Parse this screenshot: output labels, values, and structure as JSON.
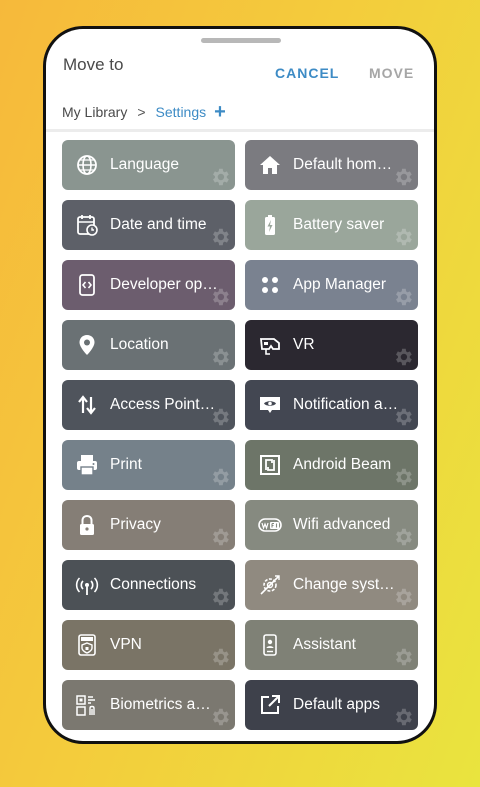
{
  "dialog": {
    "title": "Move to",
    "cancel_label": "CANCEL",
    "move_label": "MOVE"
  },
  "breadcrumb": {
    "root": "My Library",
    "separator": ">",
    "current": "Settings",
    "add": "+"
  },
  "tiles": [
    {
      "label": "Language",
      "icon": "globe-icon",
      "color": "#8a9590"
    },
    {
      "label": "Default hom…",
      "icon": "home-icon",
      "color": "#7b7b80"
    },
    {
      "label": "Date and time",
      "icon": "calendar-clock-icon",
      "color": "#5d6068"
    },
    {
      "label": "Battery saver",
      "icon": "battery-icon",
      "color": "#9aa69b"
    },
    {
      "label": "Developer op…",
      "icon": "developer-icon",
      "color": "#6c5d6e"
    },
    {
      "label": "App Manager",
      "icon": "apps-icon",
      "color": "#7a8290"
    },
    {
      "label": "Location",
      "icon": "location-pin-icon",
      "color": "#6a7174"
    },
    {
      "label": "VR",
      "icon": "vr-headset-icon",
      "color": "#2b2830"
    },
    {
      "label": "Access Point…",
      "icon": "transfer-arrows-icon",
      "color": "#4f545c"
    },
    {
      "label": "Notification a…",
      "icon": "notification-eye-icon",
      "color": "#434752"
    },
    {
      "label": "Print",
      "icon": "printer-icon",
      "color": "#75818a"
    },
    {
      "label": "Android Beam",
      "icon": "nfc-icon",
      "color": "#6d7568"
    },
    {
      "label": "Privacy",
      "icon": "lock-icon",
      "color": "#857e76"
    },
    {
      "label": "Wifi advanced",
      "icon": "wifi-badge-icon",
      "color": "#868a80"
    },
    {
      "label": "Connections",
      "icon": "antenna-icon",
      "color": "#4c5156"
    },
    {
      "label": "Change syst…",
      "icon": "system-gear-icon",
      "color": "#908a80"
    },
    {
      "label": "VPN",
      "icon": "vpn-shield-icon",
      "color": "#7a7466"
    },
    {
      "label": "Assistant",
      "icon": "assistant-phone-icon",
      "color": "#7f8176"
    },
    {
      "label": "Biometrics a…",
      "icon": "biometrics-icon",
      "color": "#7b7870"
    },
    {
      "label": "Default apps",
      "icon": "open-external-icon",
      "color": "#3e414b"
    }
  ],
  "colors": {
    "accent": "#3d8bc5",
    "disabled": "#a6a6a6"
  }
}
